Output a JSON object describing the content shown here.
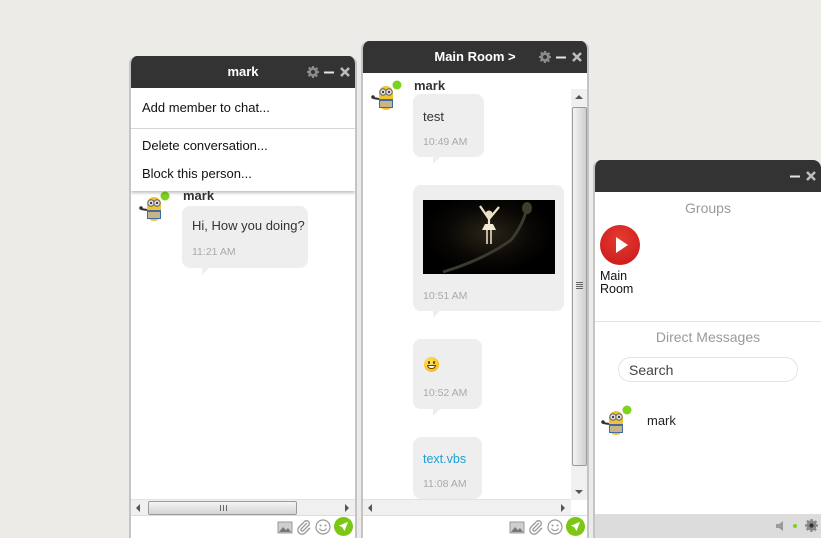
{
  "windows": {
    "mark_chat": {
      "title": "mark",
      "menu": {
        "items": [
          "Add member to chat...",
          "Delete conversation...",
          "Block this person..."
        ]
      },
      "messages": [
        {
          "sender": "mark",
          "text": "Hi, How you doing?",
          "time": "11:21 AM"
        }
      ]
    },
    "main_room": {
      "title": "Main Room >",
      "sender": "mark",
      "messages": [
        {
          "type": "text",
          "text": "test",
          "time": "10:49 AM"
        },
        {
          "type": "image",
          "alt": "ballerina-photo",
          "time": "10:51 AM"
        },
        {
          "type": "emoji",
          "emoji": "smiley",
          "time": "10:52 AM"
        },
        {
          "type": "file",
          "text": "text.vbs",
          "time": "11:08 AM"
        }
      ]
    },
    "contacts": {
      "groups_title": "Groups",
      "groups": [
        {
          "label": "Main Room"
        }
      ],
      "dm_title": "Direct Messages",
      "search_placeholder": "Search",
      "contacts": [
        {
          "name": "mark",
          "status": "online"
        }
      ]
    }
  },
  "icons": {
    "settings": "gear-icon",
    "minimize": "minimize-icon",
    "close": "close-icon",
    "image": "image-icon",
    "attach": "paperclip-icon",
    "emoji": "smiley-icon",
    "send": "send-icon",
    "sound": "speaker-icon"
  },
  "colors": {
    "titlebar": "#333333",
    "send_button": "#7cc713",
    "online_dot": "#7cd31b",
    "group_button": "#d7201f",
    "link": "#1a9fd6"
  }
}
